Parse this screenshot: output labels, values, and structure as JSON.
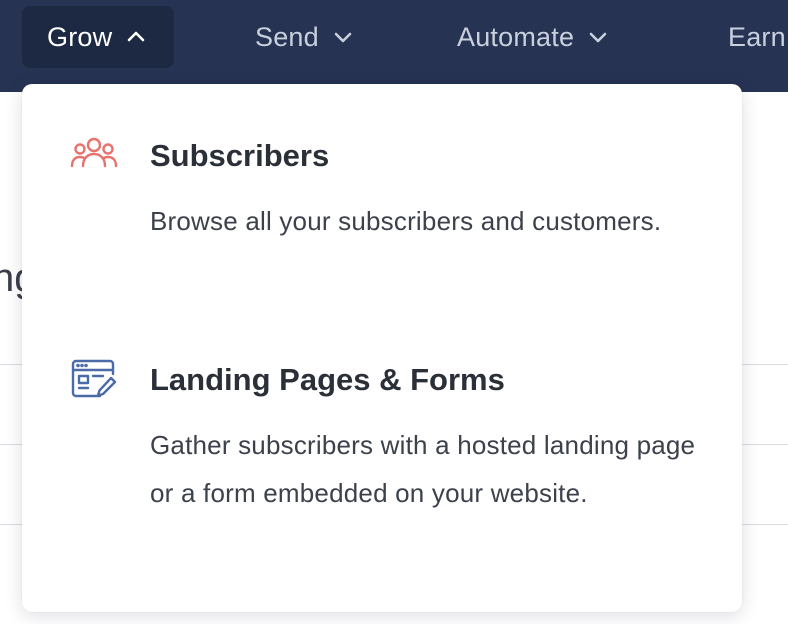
{
  "nav": {
    "items": [
      {
        "label": "Grow",
        "active": true
      },
      {
        "label": "Send"
      },
      {
        "label": "Automate"
      },
      {
        "label": "Earn"
      }
    ]
  },
  "background": {
    "fragment_text": "ng"
  },
  "dropdown": {
    "entries": [
      {
        "icon": "subscribers-icon",
        "title": "Subscribers",
        "description": "Browse all your subscribers and customers."
      },
      {
        "icon": "landing-page-form-icon",
        "title": "Landing Pages & Forms",
        "description": "Gather subscribers with a hosted landing page or a form embedded on your website."
      }
    ]
  },
  "colors": {
    "nav_background": "#263352",
    "nav_active_background": "#1d2943",
    "subscribers_icon": "#e8726d",
    "landing_icon": "#4a6aa8"
  }
}
